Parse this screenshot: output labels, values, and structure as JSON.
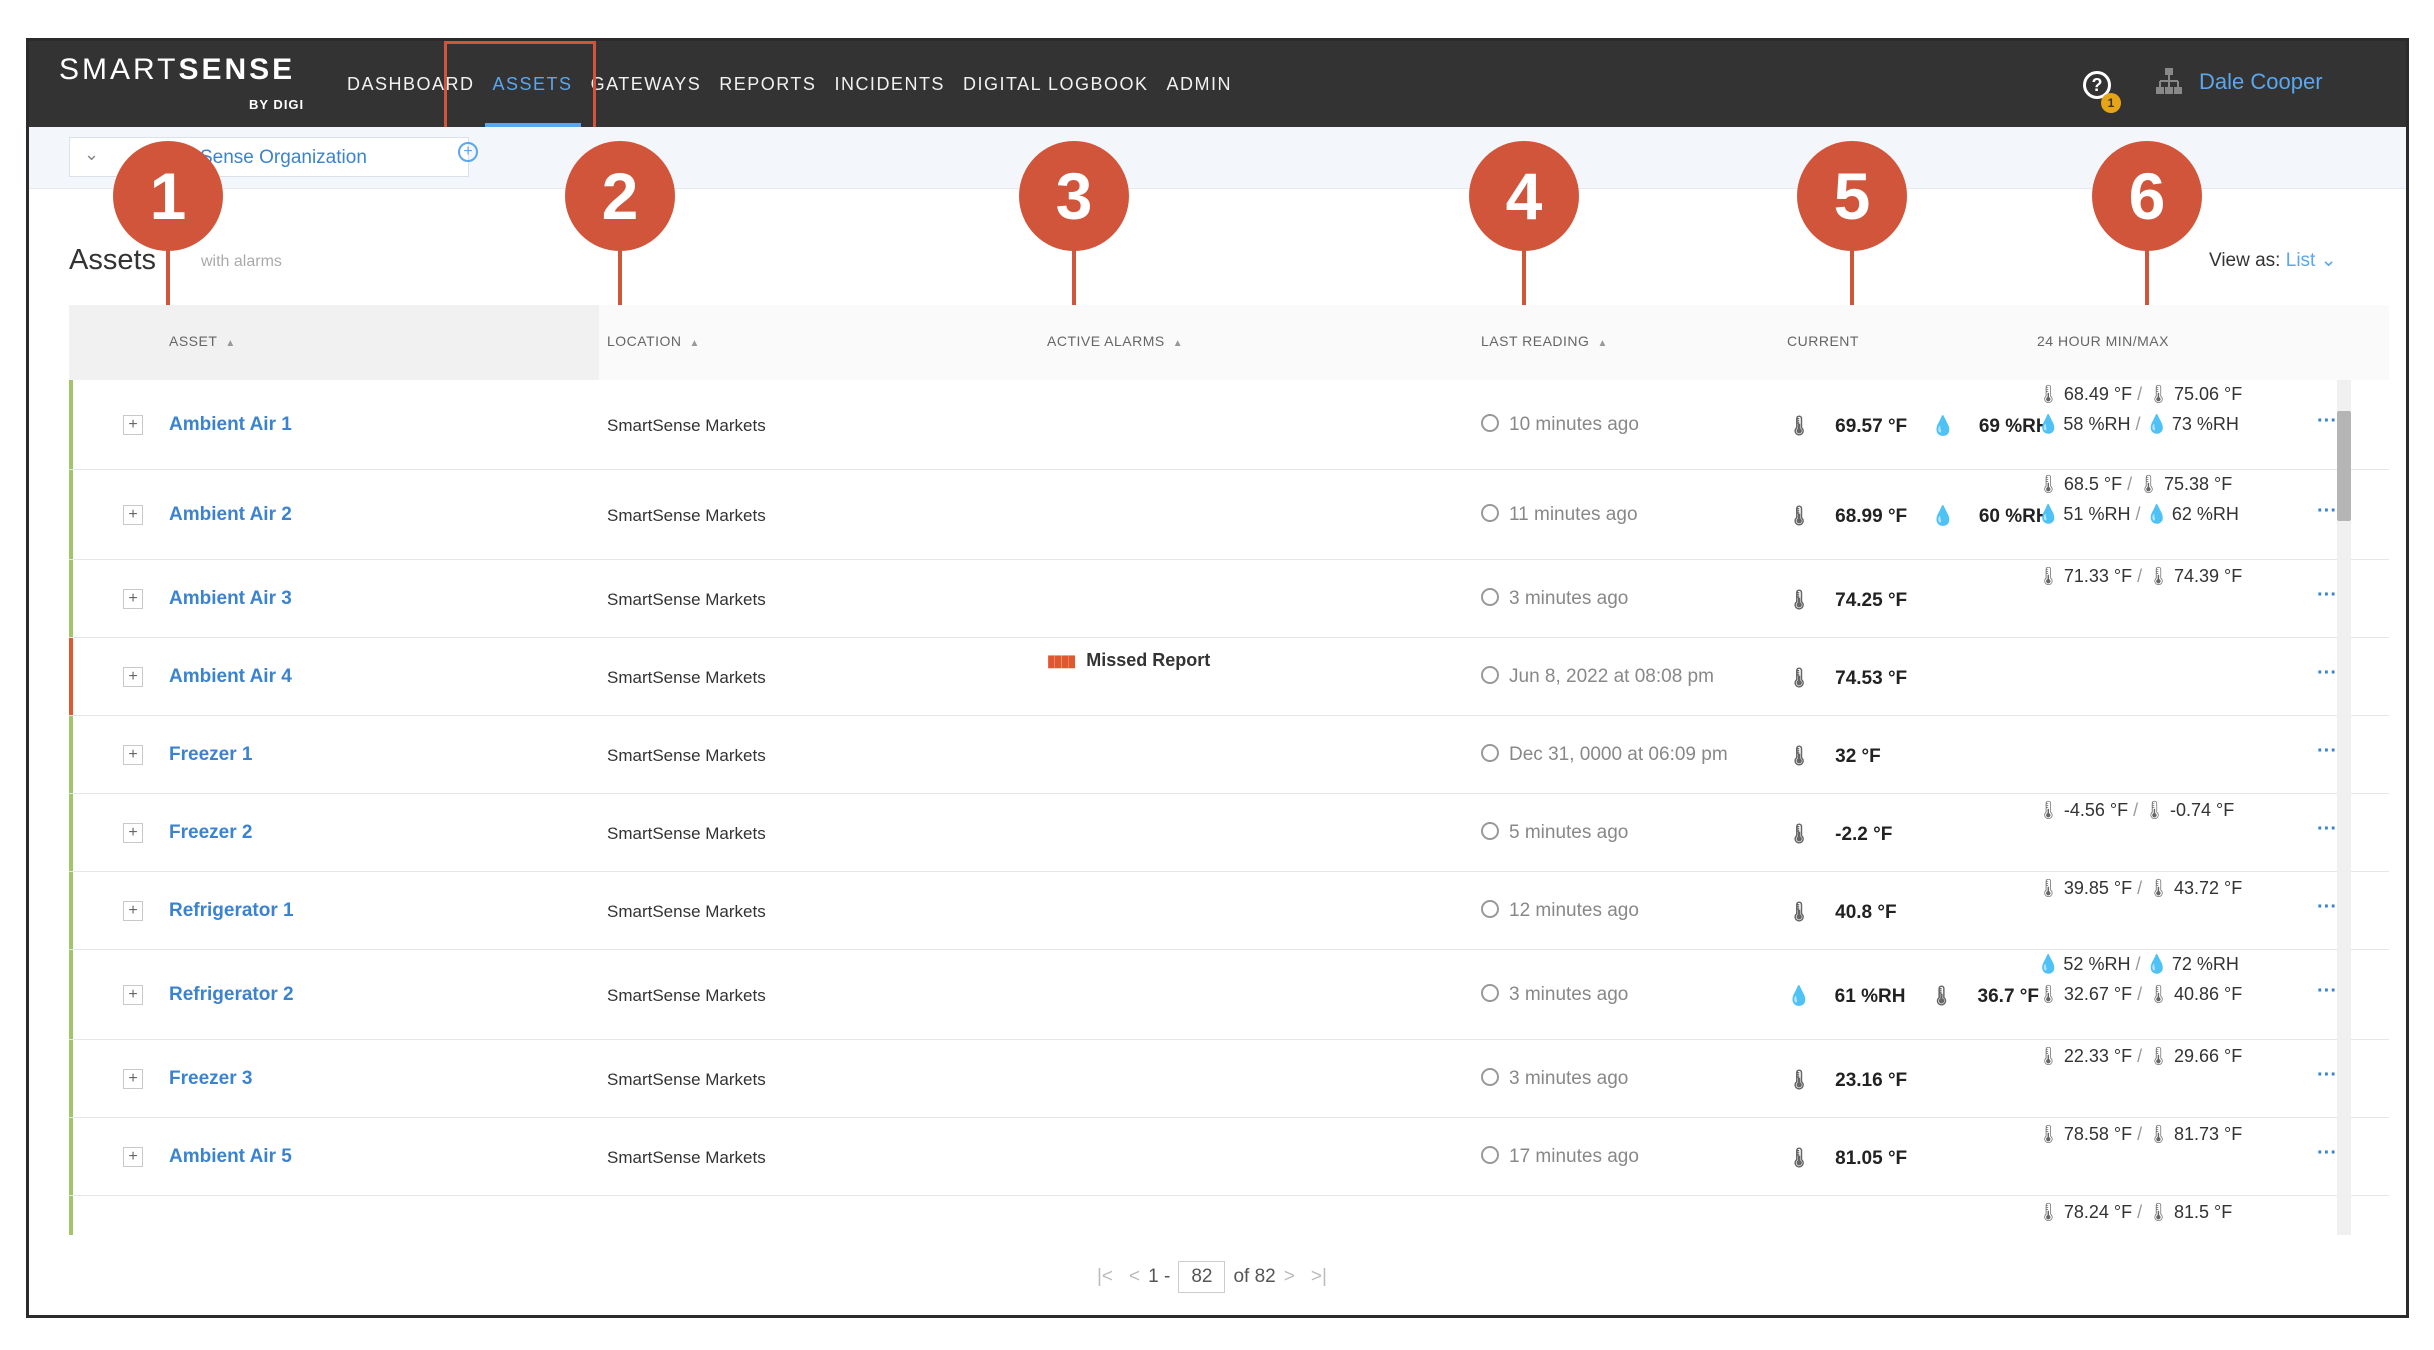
{
  "header": {
    "logo_main": "SMART",
    "logo_bold": "SENSE",
    "logo_sub": "BY DIGI",
    "nav": [
      "DASHBOARD",
      "ASSETS",
      "GATEWAYS",
      "REPORTS",
      "INCIDENTS",
      "DIGITAL LOGBOOK",
      "ADMIN"
    ],
    "active_nav": "ASSETS",
    "help_badge": "1",
    "user": "Dale Cooper"
  },
  "breadcrumb": {
    "label": "Sense Organization"
  },
  "assets": {
    "title": "Assets",
    "subtitle": "with alarms",
    "view_as_label": "View as:",
    "view_as_value": "List"
  },
  "columns": [
    "ASSET",
    "LOCATION",
    "ACTIVE ALARMS",
    "LAST READING",
    "CURRENT",
    "24 HOUR MIN/MAX"
  ],
  "rows": [
    {
      "asset": "Ambient Air 1",
      "location": "SmartSense Markets",
      "alarm": "",
      "last": "10 minutes ago",
      "current": [
        "69.57 °F",
        "69 %RH"
      ],
      "mm": [
        "68.49 °F",
        "75.06 °F",
        "58 %RH",
        "73 %RH"
      ]
    },
    {
      "asset": "Ambient Air 2",
      "location": "SmartSense Markets",
      "alarm": "",
      "last": "11 minutes ago",
      "current": [
        "68.99 °F",
        "60 %RH"
      ],
      "mm": [
        "68.5 °F",
        "75.38 °F",
        "51 %RH",
        "62 %RH"
      ]
    },
    {
      "asset": "Ambient Air 3",
      "location": "SmartSense Markets",
      "alarm": "",
      "last": "3 minutes ago",
      "current": [
        "74.25 °F"
      ],
      "mm": [
        "71.33 °F",
        "74.39 °F"
      ]
    },
    {
      "asset": "Ambient Air 4",
      "location": "SmartSense Markets",
      "alarm": "Missed Report",
      "last": "Jun 8, 2022 at 08:08 pm",
      "current": [
        "74.53 °F"
      ],
      "mm": []
    },
    {
      "asset": "Freezer 1",
      "location": "SmartSense Markets",
      "alarm": "",
      "last": "Dec 31, 0000 at 06:09 pm",
      "current": [
        "32 °F"
      ],
      "mm": []
    },
    {
      "asset": "Freezer 2",
      "location": "SmartSense Markets",
      "alarm": "",
      "last": "5 minutes ago",
      "current": [
        "-2.2 °F"
      ],
      "mm": [
        "-4.56 °F",
        "-0.74 °F"
      ]
    },
    {
      "asset": "Refrigerator 1",
      "location": "SmartSense Markets",
      "alarm": "",
      "last": "12 minutes ago",
      "current": [
        "40.8 °F"
      ],
      "mm": [
        "39.85 °F",
        "43.72 °F"
      ]
    },
    {
      "asset": "Refrigerator 2",
      "location": "SmartSense Markets",
      "alarm": "",
      "last": "3 minutes ago",
      "current": [
        "61 %RH",
        "36.7 °F"
      ],
      "mm": [
        "52 %RH",
        "72 %RH",
        "32.67 °F",
        "40.86 °F"
      ]
    },
    {
      "asset": "Freezer 3",
      "location": "SmartSense Markets",
      "alarm": "",
      "last": "3 minutes ago",
      "current": [
        "23.16 °F"
      ],
      "mm": [
        "22.33 °F",
        "29.66 °F"
      ]
    },
    {
      "asset": "Ambient Air 5",
      "location": "SmartSense Markets",
      "alarm": "",
      "last": "17 minutes ago",
      "current": [
        "81.05 °F"
      ],
      "mm": [
        "78.58 °F",
        "81.73 °F"
      ]
    },
    {
      "asset": "",
      "location": "",
      "alarm": "",
      "last": "",
      "current": [],
      "mm": [
        "78.24 °F",
        "81.5 °F"
      ]
    }
  ],
  "pager": {
    "range_start": "1 -",
    "page_value": "82",
    "total": "of 82"
  },
  "markers": [
    "1",
    "2",
    "3",
    "4",
    "5",
    "6"
  ],
  "colors": {
    "topbar": "#333333",
    "accent": "#5aa7ee",
    "marker": "#d0553a",
    "ok_bar": "#a3c56a",
    "alarm_bar": "#e0582f"
  }
}
